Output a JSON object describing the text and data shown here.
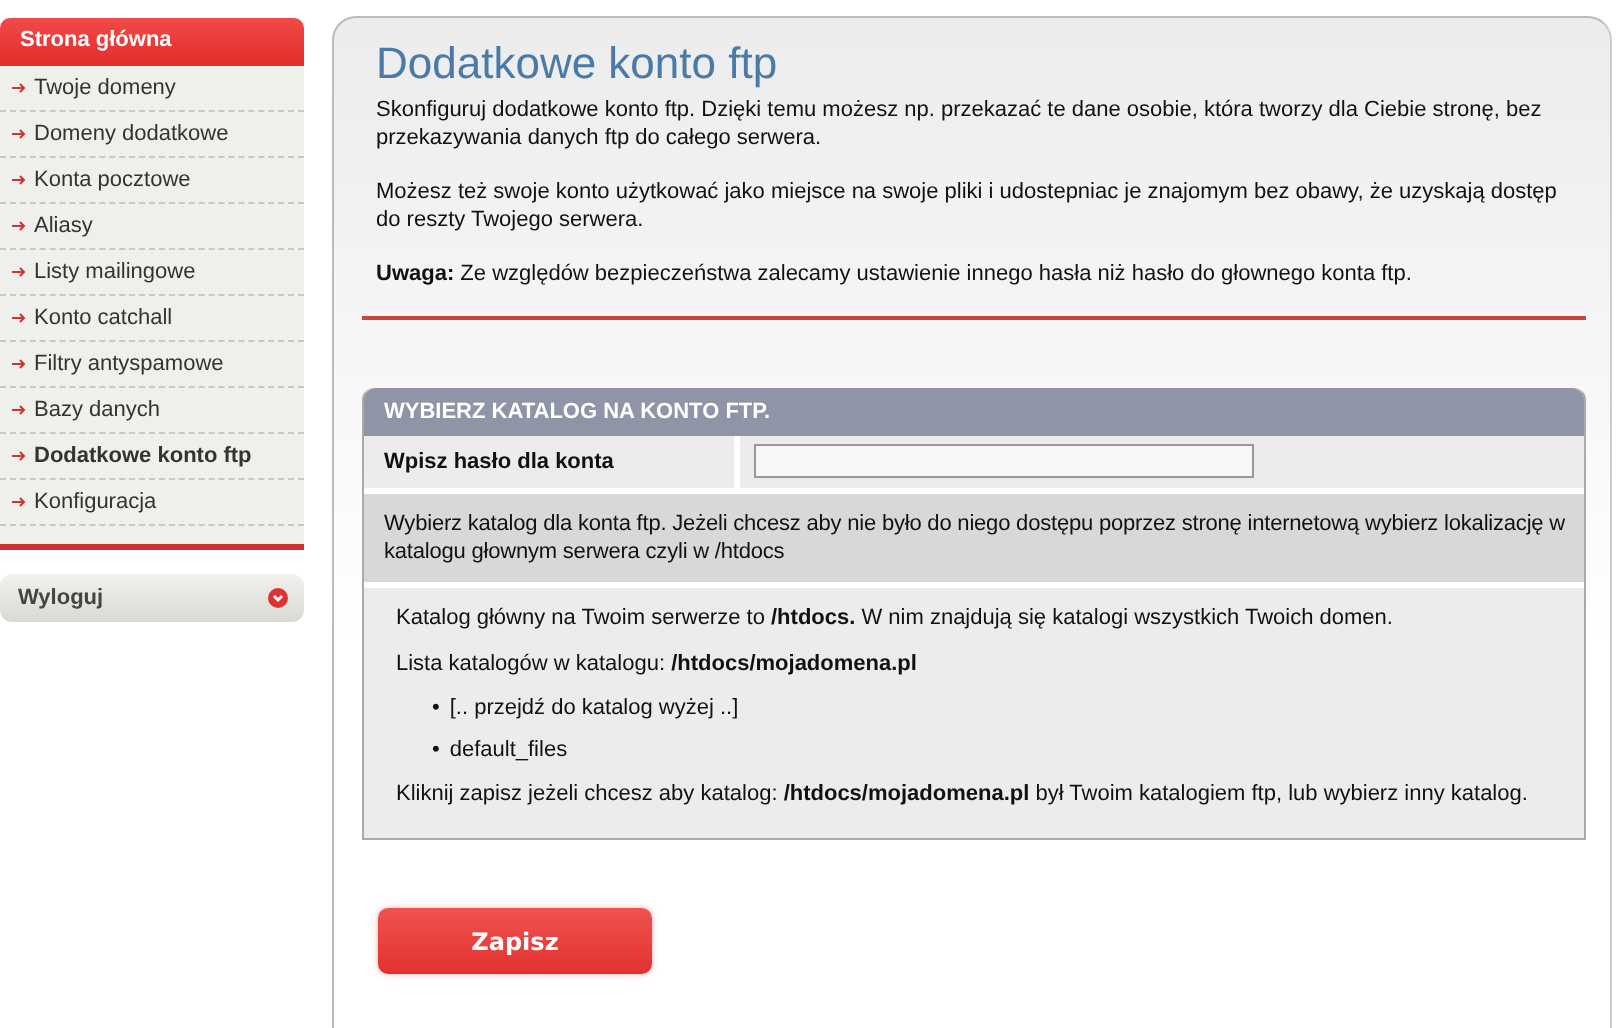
{
  "sidebar": {
    "header": "Strona główna",
    "items": [
      {
        "label": "Twoje domeny",
        "selected": false
      },
      {
        "label": "Domeny dodatkowe",
        "selected": false
      },
      {
        "label": "Konta pocztowe",
        "selected": false
      },
      {
        "label": "Aliasy",
        "selected": false
      },
      {
        "label": "Listy mailingowe",
        "selected": false
      },
      {
        "label": "Konto catchall",
        "selected": false
      },
      {
        "label": "Filtry antyspamowe",
        "selected": false
      },
      {
        "label": "Bazy danych",
        "selected": false
      },
      {
        "label": "Dodatkowe konto ftp",
        "selected": true
      },
      {
        "label": "Konfiguracja",
        "selected": false
      }
    ],
    "logout": "Wyloguj"
  },
  "main": {
    "title": "Dodatkowe konto ftp",
    "paragraphs": [
      "Skonfiguruj dodatkowe konto ftp. Dzięki temu możesz np. przekazać te dane osobie, która tworzy dla Ciebie stronę, bez przekazywania danych ftp do całego serwera.",
      "Możesz też swoje konto użytkować jako miejsce na swoje pliki i udostepniac je znajomym bez obawy, że uzyskają dostęp do reszty Twojego serwera.",
      "**Uwaga:** Ze względów bezpieczeństwa zalecamy ustawienie innego hasła niż hasło do głownego konta ftp."
    ],
    "section": {
      "header": "WYBIERZ KATALOG NA KONTO FTP.",
      "password_label": "Wpisz hasło dla konta",
      "description": "Wybierz katalog dla konta ftp. Jeżeli chcesz aby nie było do niego dostępu poprzez stronę internetową wybierz lokalizację w katalogu głownym serwera czyli w /htdocs",
      "root_info": "Katalog główny na Twoim serwerze to **/htdocs.** W nim znajdują się katalogi wszystkich Twoich domen.",
      "list_info": "Lista katalogów w katalogu: **/htdocs/mojadomena.pl**",
      "directories": [
        {
          "bullet": "•",
          "name": "[.. przejdź do katalog wyżej ..]"
        },
        {
          "bullet": "•",
          "name": "default_files"
        }
      ],
      "footer": "Kliknij zapisz jeżeli chcesz aby katalog: **/htdocs/mojadomena.pl** był Twoim katalogiem ftp, lub wybierz inny katalog."
    },
    "save_button": "Zapisz"
  }
}
